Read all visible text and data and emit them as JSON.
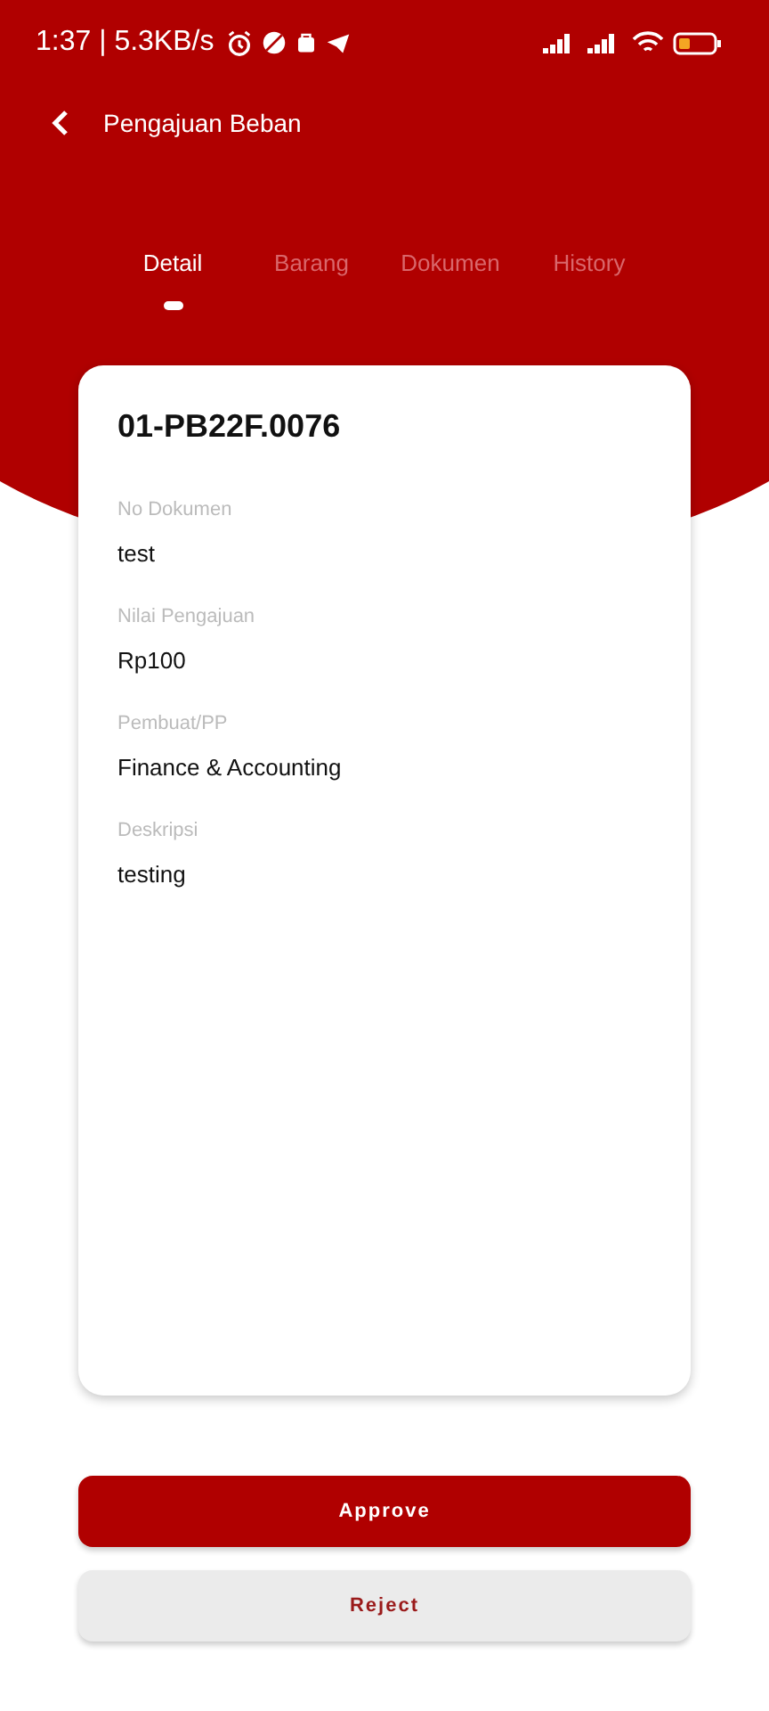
{
  "status_bar": {
    "time": "1:37 | 5.3KB/s"
  },
  "app_bar": {
    "title": "Pengajuan Beban"
  },
  "tabs": [
    {
      "label": "Detail",
      "selected": true
    },
    {
      "label": "Barang",
      "selected": false
    },
    {
      "label": "Dokumen",
      "selected": false
    },
    {
      "label": "History",
      "selected": false
    }
  ],
  "card": {
    "title": "01-PB22F.0076",
    "fields": [
      {
        "label": "No Dokumen",
        "value": "test"
      },
      {
        "label": "Nilai Pengajuan",
        "value": "Rp100"
      },
      {
        "label": "Pembuat/PP",
        "value": "Finance & Accounting"
      },
      {
        "label": "Deskripsi",
        "value": "testing"
      }
    ]
  },
  "buttons": [
    {
      "label": "Approve",
      "kind": "primary"
    },
    {
      "label": "Reject",
      "kind": "secondary"
    }
  ]
}
